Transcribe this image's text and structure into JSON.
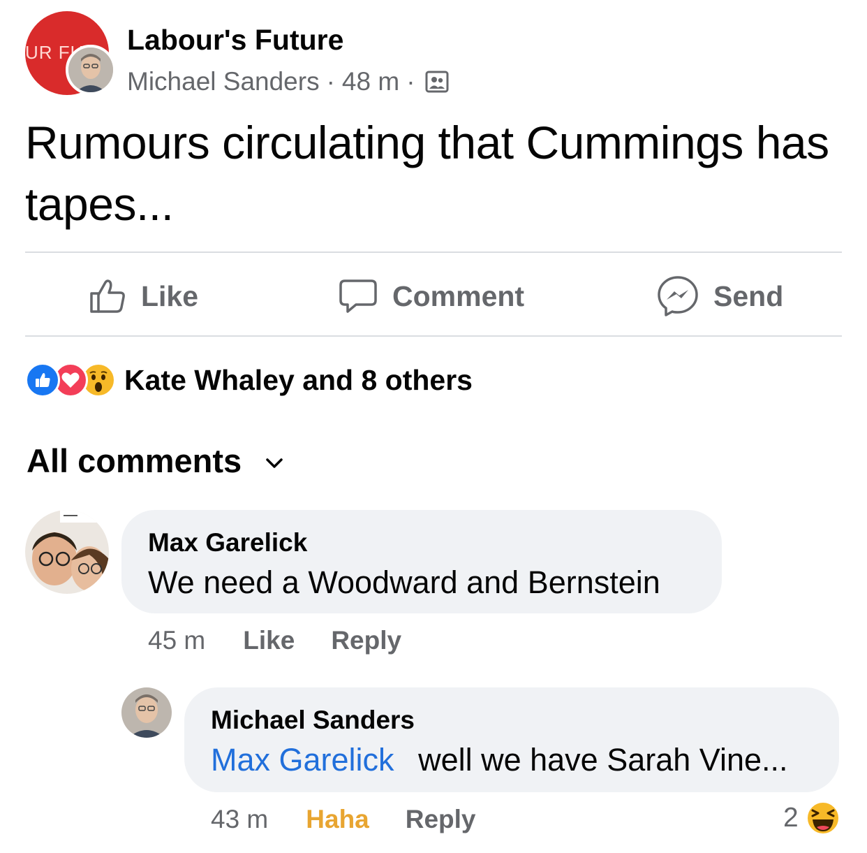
{
  "post": {
    "group_name": "Labour's Future",
    "group_avatar_text": "UR FU",
    "author": "Michael Sanders",
    "time": "48 m",
    "separator": "·",
    "text": "Rumours circulating that Cummings has tapes..."
  },
  "actions": {
    "like": "Like",
    "comment": "Comment",
    "send": "Send"
  },
  "reactions": {
    "types": [
      "like",
      "love",
      "wow"
    ],
    "summary": "Kate Whaley and 8 others"
  },
  "comments_header": {
    "label": "All comments"
  },
  "comments": [
    {
      "author": "Max Garelick",
      "text": "We need a Woodward and Bernstein",
      "time": "45 m",
      "like_label": "Like",
      "reply_label": "Reply"
    },
    {
      "author": "Michael Sanders",
      "mention": "Max Garelick",
      "text": "well we have Sarah Vine...",
      "time": "43 m",
      "reaction_label": "Haha",
      "reply_label": "Reply",
      "reaction_count": "2"
    }
  ],
  "colors": {
    "link": "#216fdb",
    "secondary_text": "#65676b",
    "bubble_bg": "#f0f2f5",
    "haha": "#e8a531",
    "like_blue": "#1877f2",
    "love_red": "#f33e58",
    "wow_yellow": "#f7b928",
    "group_red": "#d92b2b"
  }
}
